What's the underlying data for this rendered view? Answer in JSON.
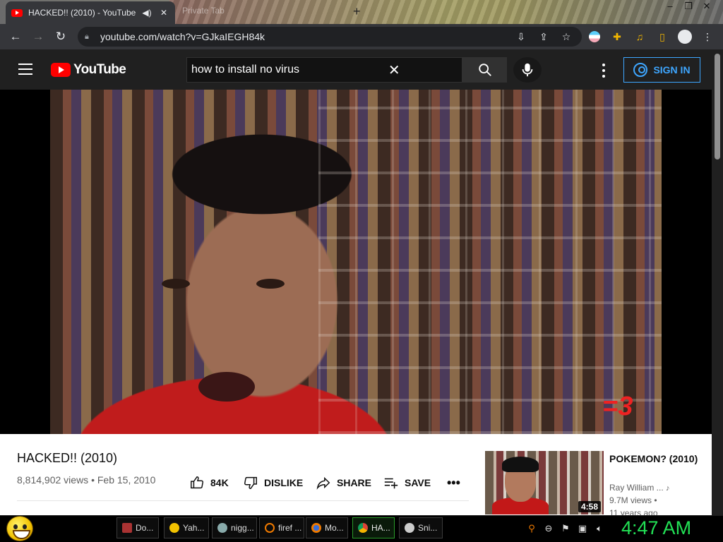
{
  "browser": {
    "tab_title": "HACKED!! (2010) - YouTube",
    "ghost_tab": "Private Tab",
    "url": "youtube.com/watch?v=GJkaIEGH84k"
  },
  "youtube": {
    "logo_text": "YouTube",
    "search_value": "how to install no virus",
    "sign_in_label": "SIGN IN"
  },
  "video": {
    "watermark": "=3",
    "title": "HACKED!! (2010)",
    "meta": "8,814,902 views • Feb 15, 2010",
    "actions": {
      "like": "84K",
      "dislike": "DISLIKE",
      "share": "SHARE",
      "save": "SAVE"
    }
  },
  "related": {
    "title": "POKEMON? (2010)",
    "channel": "Ray William ...",
    "views": "9.7M views •",
    "age": "11 years ago",
    "duration": "4:58"
  },
  "taskbar": {
    "items": [
      {
        "label": "Do..."
      },
      {
        "label": "Yah..."
      },
      {
        "label": "nigg..."
      },
      {
        "label": "firef ..."
      },
      {
        "label": "Mo..."
      },
      {
        "label": "HA..."
      },
      {
        "label": "Sni..."
      }
    ],
    "clock": "4:47 AM"
  },
  "colors": {
    "accent_blue": "#3ea6ff",
    "youtube_red": "#ff0000",
    "clock_green": "#22e055"
  }
}
